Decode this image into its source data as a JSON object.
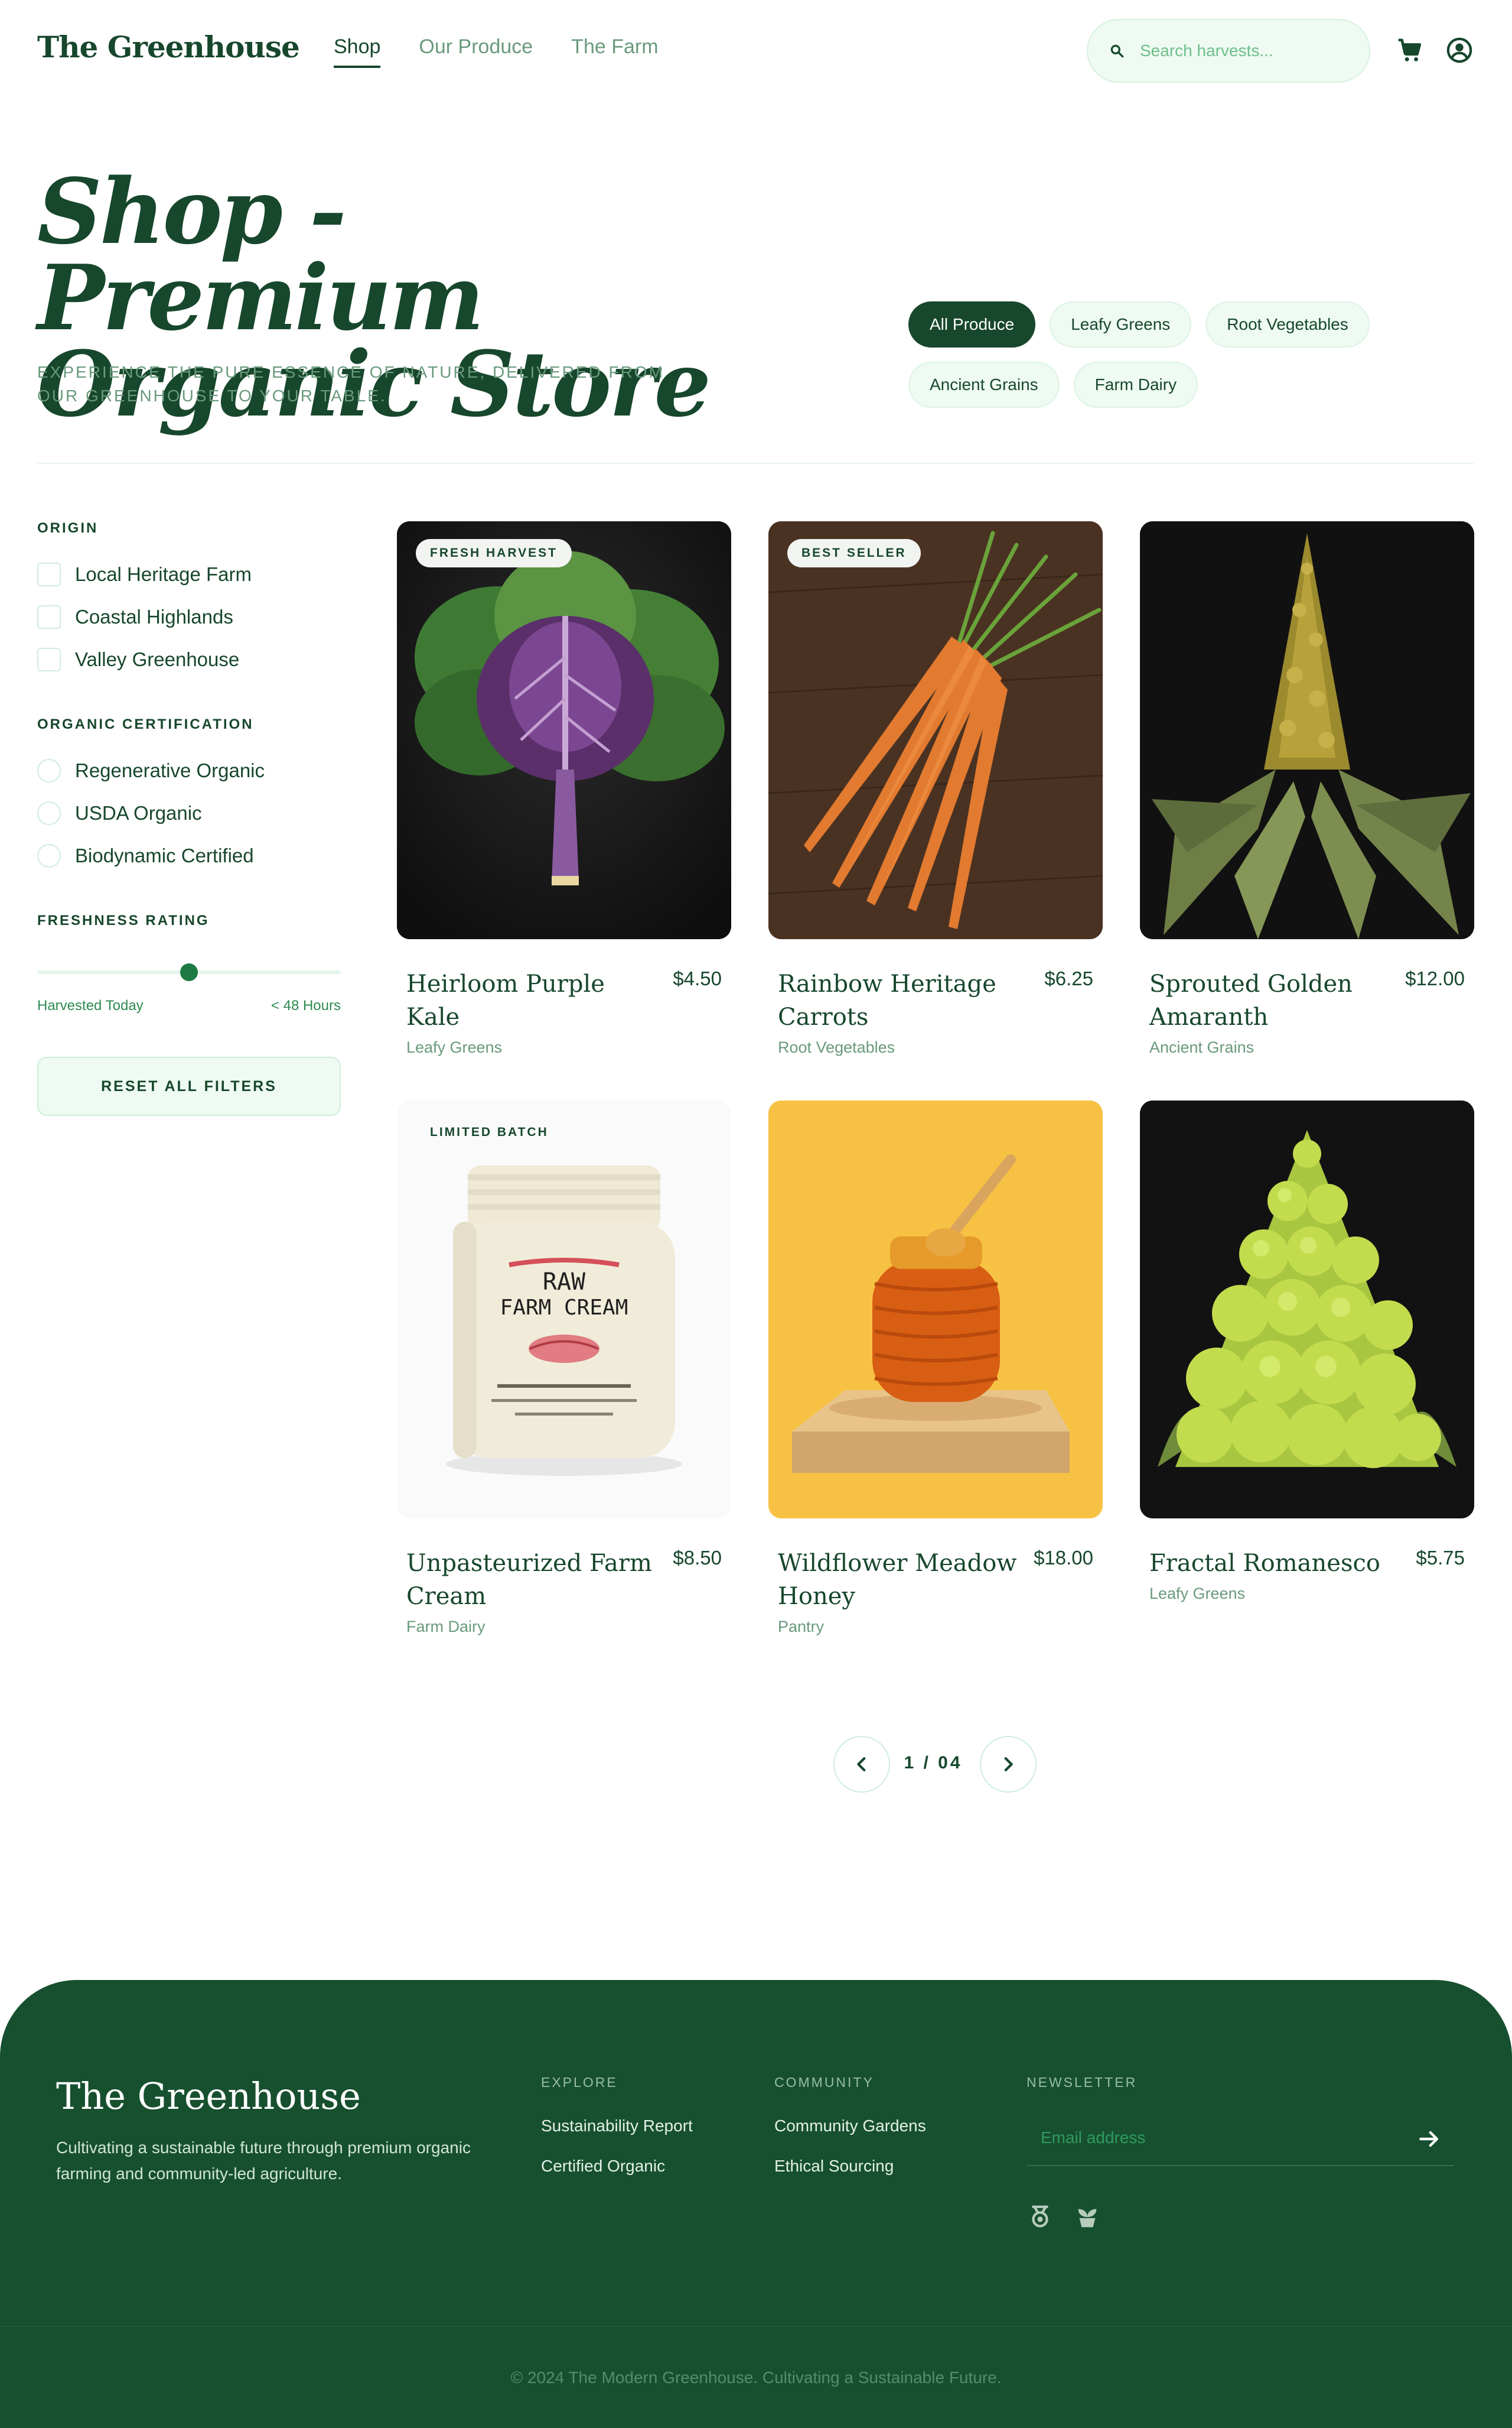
{
  "header": {
    "logo": "The Greenhouse",
    "nav": [
      "Shop",
      "Our Produce",
      "The Farm"
    ],
    "search_placeholder": "Search harvests..."
  },
  "hero": {
    "title_line1": "Shop - Premium",
    "title_line2": "Organic Store",
    "subtitle": "Experience the pure essence of nature, delivered from our greenhouse to your table.",
    "chips": [
      "All Produce",
      "Leafy Greens",
      "Root Vegetables",
      "Ancient Grains",
      "Farm Dairy"
    ],
    "active_chip": "All Produce"
  },
  "filters": {
    "origin": {
      "heading": "Origin",
      "options": [
        "Local Heritage Farm",
        "Coastal Highlands",
        "Valley Greenhouse"
      ]
    },
    "certification": {
      "heading": "Organic Certification",
      "options": [
        "Regenerative Organic",
        "USDA Organic",
        "Biodynamic Certified"
      ]
    },
    "freshness": {
      "heading": "Freshness Rating",
      "min_label": "Harvested Today",
      "max_label": "< 48 Hours",
      "value": 0.5
    },
    "reset_label": "Reset All Filters"
  },
  "products": [
    {
      "badge": "Fresh Harvest",
      "name": "Heirloom Purple Kale",
      "price": "$4.50",
      "category": "Leafy Greens",
      "image": "kale"
    },
    {
      "badge": "Best Seller",
      "name": "Rainbow Heritage Carrots",
      "price": "$6.25",
      "category": "Root Vegetables",
      "image": "carrots"
    },
    {
      "badge": "",
      "name": "Sprouted Golden Amaranth",
      "price": "$12.00",
      "category": "Ancient Grains",
      "image": "amaranth"
    },
    {
      "badge": "Limited Batch",
      "name": "Unpasteurized Farm Cream",
      "price": "$8.50",
      "category": "Farm Dairy",
      "image": "cream-jar",
      "jar_label_1": "RAW",
      "jar_label_2": "FARM  CREAM"
    },
    {
      "badge": "",
      "name": "Wildflower Meadow Honey",
      "price": "$18.00",
      "category": "Pantry",
      "image": "honey"
    },
    {
      "badge": "",
      "name": "Fractal Romanesco",
      "price": "$5.75",
      "category": "Leafy Greens",
      "image": "romanesco"
    }
  ],
  "pagination": {
    "current": "1 / 04"
  },
  "footer": {
    "brand": "The Greenhouse",
    "description": "Cultivating a sustainable future through premium organic farming and community-led agriculture.",
    "explore": {
      "heading": "Explore",
      "links": [
        "Sustainability Report",
        "Certified Organic"
      ]
    },
    "community": {
      "heading": "Community",
      "links": [
        "Community Gardens",
        "Ethical Sourcing"
      ]
    },
    "newsletter": {
      "heading": "Newsletter",
      "placeholder": "Email address"
    },
    "copyright": "© 2024 The Modern Greenhouse. Cultivating a Sustainable Future."
  },
  "colors": {
    "primary": "#17472c",
    "accent": "#1e7a43",
    "muted": "#6a9a7c",
    "chip_bg": "#eefaf2",
    "footer_bg": "#17502f",
    "honey_bg": "#f7c244"
  },
  "icons": [
    "search-icon",
    "cart-icon",
    "account-icon",
    "chevron-left-icon",
    "chevron-right-icon",
    "arrow-right-icon",
    "award-icon",
    "plant-icon"
  ]
}
